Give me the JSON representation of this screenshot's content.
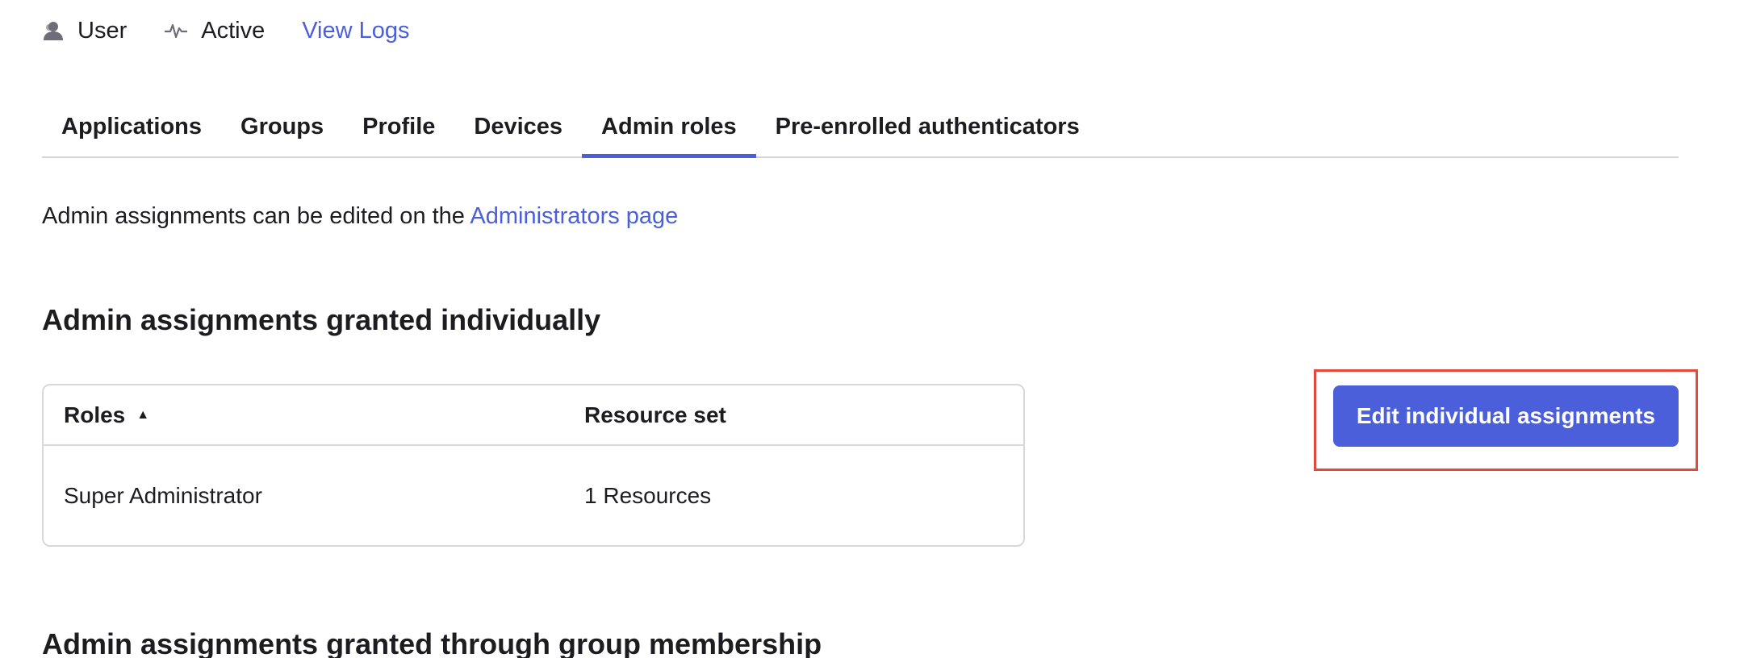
{
  "header": {
    "type_label": "User",
    "status_label": "Active",
    "logs_link": "View Logs",
    "icons": {
      "type": "user-icon",
      "status": "activity-pulse-icon"
    }
  },
  "tabs": [
    {
      "label": "Applications",
      "active": false
    },
    {
      "label": "Groups",
      "active": false
    },
    {
      "label": "Profile",
      "active": false
    },
    {
      "label": "Devices",
      "active": false
    },
    {
      "label": "Admin roles",
      "active": true
    },
    {
      "label": "Pre-enrolled authenticators",
      "active": false
    }
  ],
  "info": {
    "text": "Admin assignments can be edited on the ",
    "link": "Administrators page"
  },
  "individual": {
    "title": "Admin assignments granted individually",
    "columns": {
      "roles": "Roles",
      "resource_set": "Resource set"
    },
    "sort_indicator": "▲",
    "rows": [
      {
        "role": "Super Administrator",
        "resource_set": "1 Resources"
      }
    ],
    "edit_button": "Edit individual assignments"
  },
  "group": {
    "title": "Admin assignments granted through group membership"
  },
  "colors": {
    "accent": "#4a5fd9",
    "highlight": "#e34a3d",
    "border": "#d7d8dc"
  }
}
